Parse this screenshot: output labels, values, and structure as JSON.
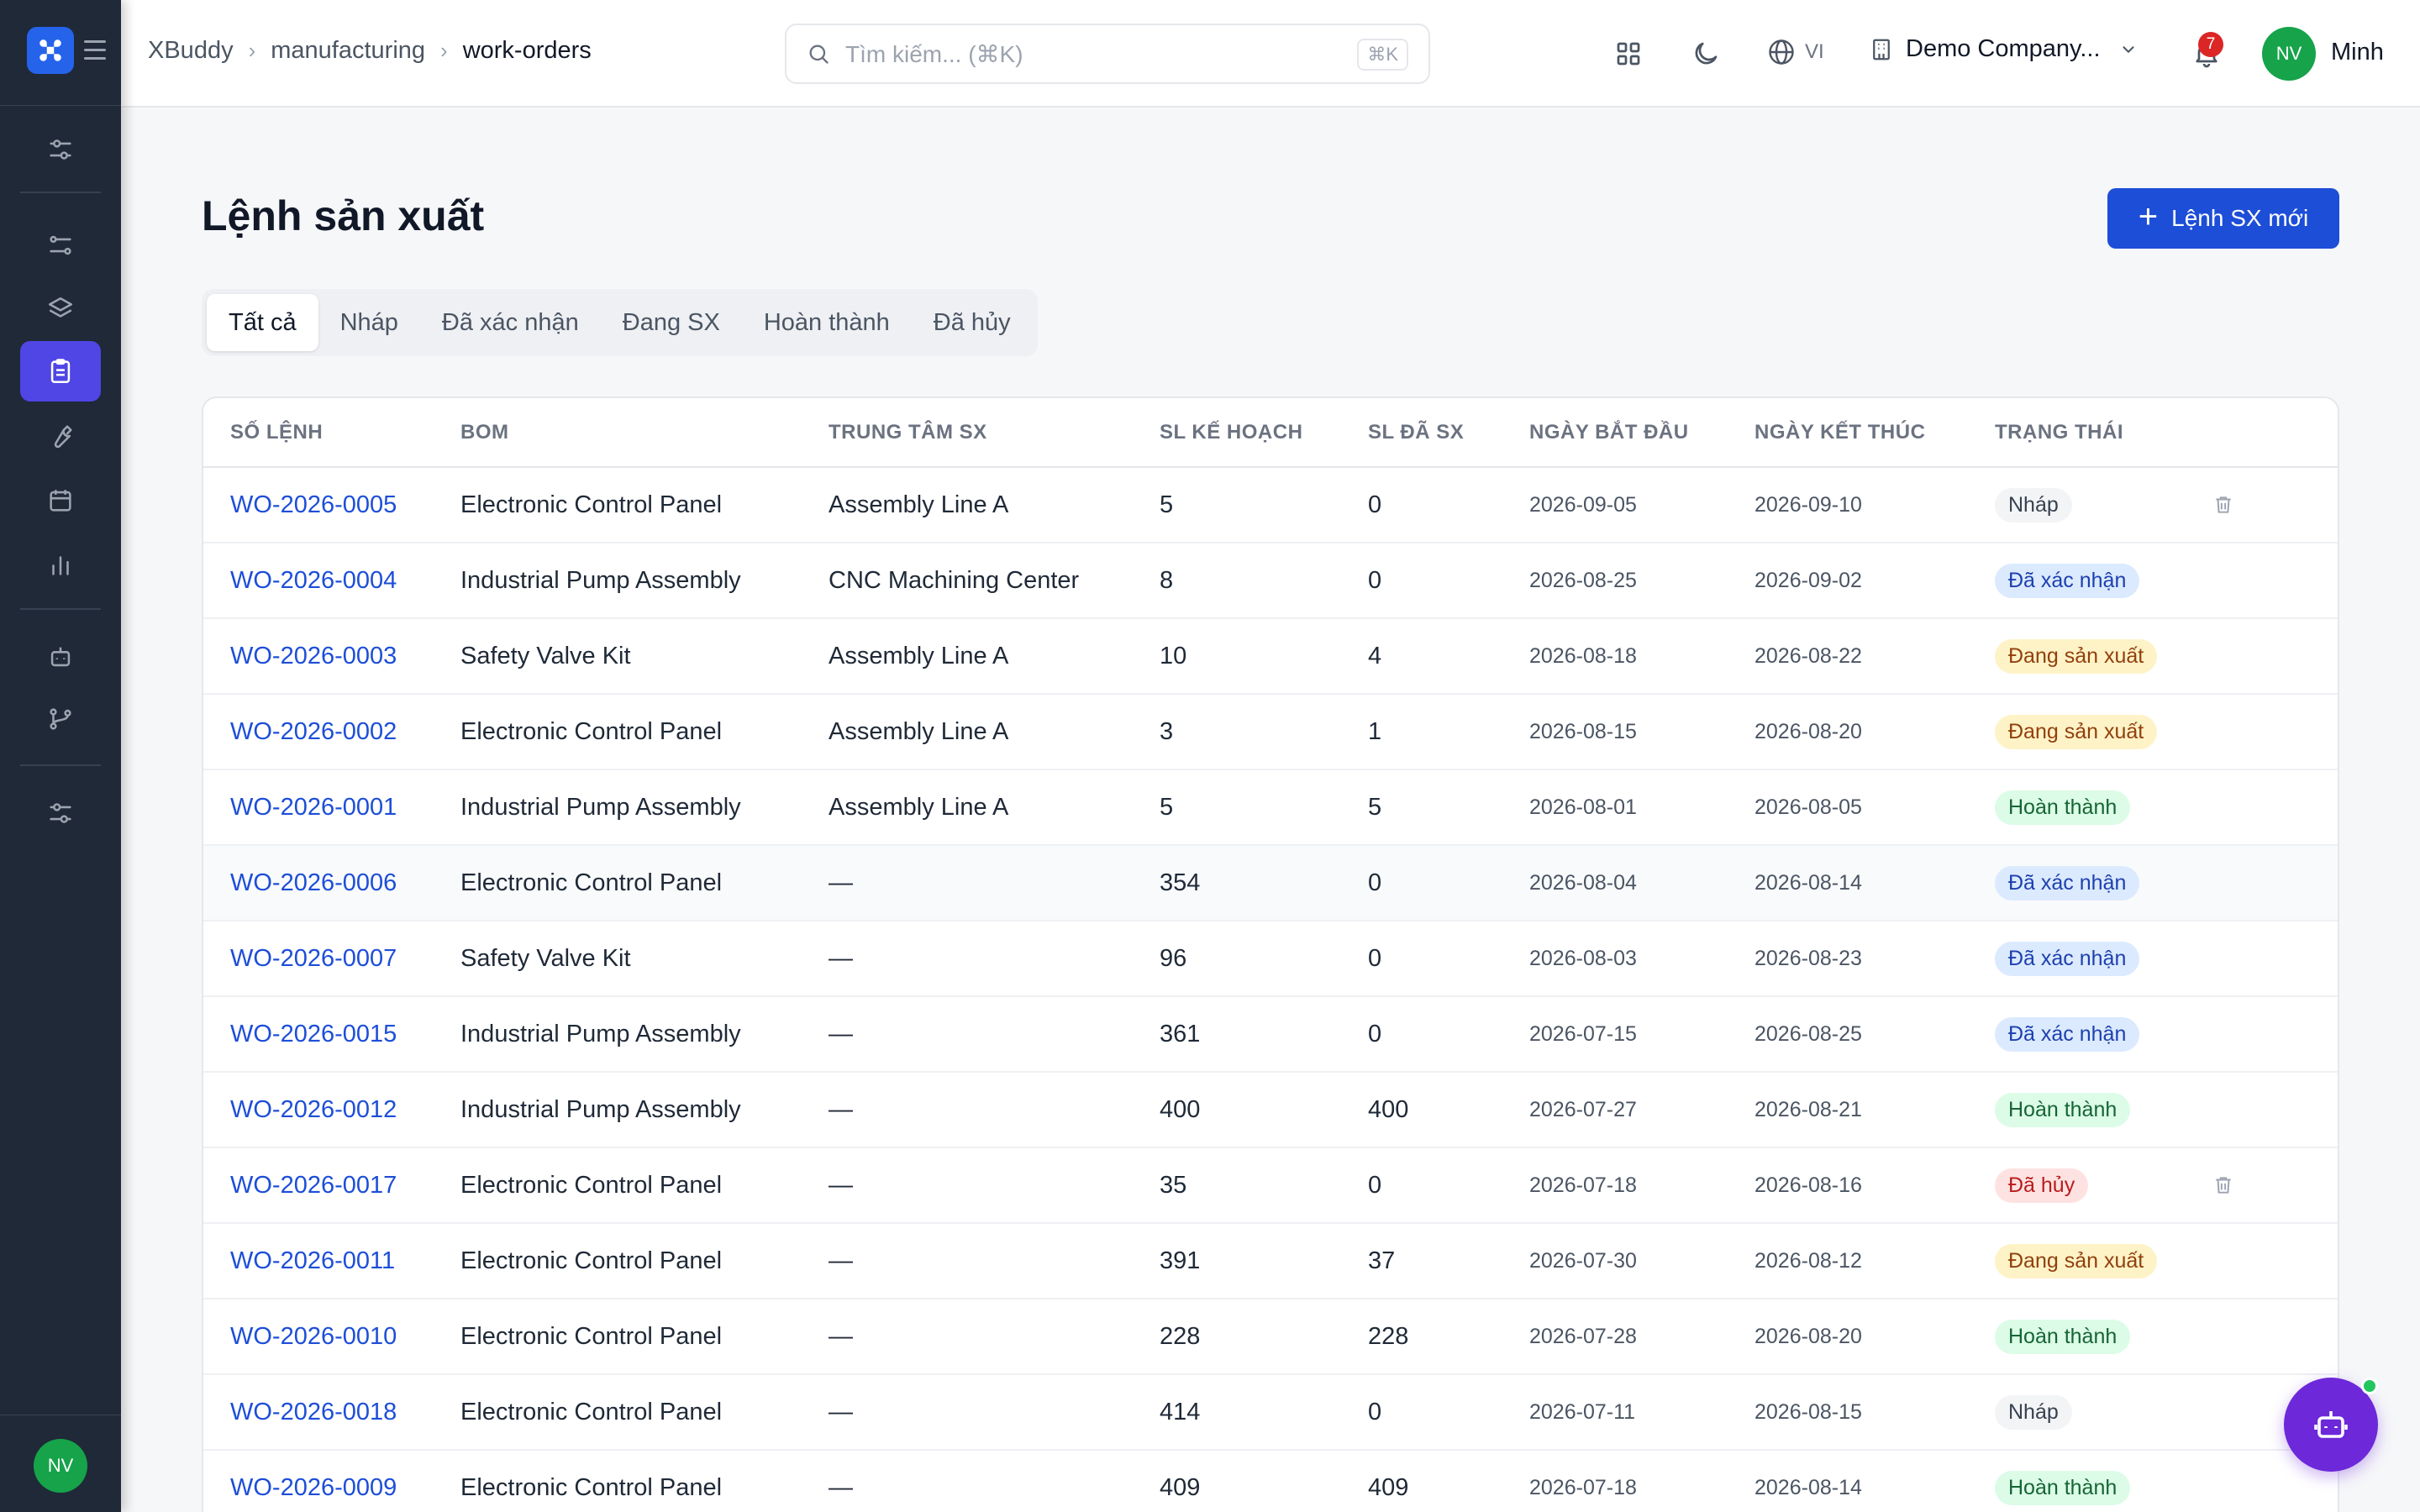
{
  "breadcrumb": [
    "XBuddy",
    "manufacturing",
    "work-orders"
  ],
  "search": {
    "placeholder": "Tìm kiếm... (⌘K)",
    "shortcut": "⌘K"
  },
  "header": {
    "language": "VI",
    "company": "Demo Company...",
    "notification_count": "7",
    "user_initials": "NV",
    "user_name": "Minh"
  },
  "sidebar": {
    "active_item": "work-orders",
    "user_initials": "NV"
  },
  "page": {
    "title": "Lệnh sản xuất",
    "new_button": "Lệnh SX mới"
  },
  "tabs": [
    "Tất cả",
    "Nháp",
    "Đã xác nhận",
    "Đang SX",
    "Hoàn thành",
    "Đã hủy"
  ],
  "table": {
    "columns": [
      "SỐ LỆNH",
      "BOM",
      "TRUNG TÂM SX",
      "SL KẾ HOẠCH",
      "SL ĐÃ SX",
      "NGÀY BẮT ĐẦU",
      "NGÀY KẾT THÚC",
      "TRẠNG THÁI"
    ],
    "rows": [
      {
        "wo": "WO-2026-0005",
        "bom": "Electronic Control Panel",
        "center": "Assembly Line A",
        "planned": "5",
        "produced": "0",
        "start": "2026-09-05",
        "end": "2026-09-10",
        "status": "Nháp",
        "status_kind": "draft",
        "deletable": true
      },
      {
        "wo": "WO-2026-0004",
        "bom": "Industrial Pump Assembly",
        "center": "CNC Machining Center",
        "planned": "8",
        "produced": "0",
        "start": "2026-08-25",
        "end": "2026-09-02",
        "status": "Đã xác nhận",
        "status_kind": "confirmed",
        "deletable": false
      },
      {
        "wo": "WO-2026-0003",
        "bom": "Safety Valve Kit",
        "center": "Assembly Line A",
        "planned": "10",
        "produced": "4",
        "start": "2026-08-18",
        "end": "2026-08-22",
        "status": "Đang sản xuất",
        "status_kind": "progress",
        "deletable": false
      },
      {
        "wo": "WO-2026-0002",
        "bom": "Electronic Control Panel",
        "center": "Assembly Line A",
        "planned": "3",
        "produced": "1",
        "start": "2026-08-15",
        "end": "2026-08-20",
        "status": "Đang sản xuất",
        "status_kind": "progress",
        "deletable": false
      },
      {
        "wo": "WO-2026-0001",
        "bom": "Industrial Pump Assembly",
        "center": "Assembly Line A",
        "planned": "5",
        "produced": "5",
        "start": "2026-08-01",
        "end": "2026-08-05",
        "status": "Hoàn thành",
        "status_kind": "done",
        "deletable": false
      },
      {
        "wo": "WO-2026-0006",
        "bom": "Electronic Control Panel",
        "center": "—",
        "planned": "354",
        "produced": "0",
        "start": "2026-08-04",
        "end": "2026-08-14",
        "status": "Đã xác nhận",
        "status_kind": "confirmed",
        "deletable": false
      },
      {
        "wo": "WO-2026-0007",
        "bom": "Safety Valve Kit",
        "center": "—",
        "planned": "96",
        "produced": "0",
        "start": "2026-08-03",
        "end": "2026-08-23",
        "status": "Đã xác nhận",
        "status_kind": "confirmed",
        "deletable": false
      },
      {
        "wo": "WO-2026-0015",
        "bom": "Industrial Pump Assembly",
        "center": "—",
        "planned": "361",
        "produced": "0",
        "start": "2026-07-15",
        "end": "2026-08-25",
        "status": "Đã xác nhận",
        "status_kind": "confirmed",
        "deletable": false
      },
      {
        "wo": "WO-2026-0012",
        "bom": "Industrial Pump Assembly",
        "center": "—",
        "planned": "400",
        "produced": "400",
        "start": "2026-07-27",
        "end": "2026-08-21",
        "status": "Hoàn thành",
        "status_kind": "done",
        "deletable": false
      },
      {
        "wo": "WO-2026-0017",
        "bom": "Electronic Control Panel",
        "center": "—",
        "planned": "35",
        "produced": "0",
        "start": "2026-07-18",
        "end": "2026-08-16",
        "status": "Đã hủy",
        "status_kind": "cancel",
        "deletable": true
      },
      {
        "wo": "WO-2026-0011",
        "bom": "Electronic Control Panel",
        "center": "—",
        "planned": "391",
        "produced": "37",
        "start": "2026-07-30",
        "end": "2026-08-12",
        "status": "Đang sản xuất",
        "status_kind": "progress",
        "deletable": false
      },
      {
        "wo": "WO-2026-0010",
        "bom": "Electronic Control Panel",
        "center": "—",
        "planned": "228",
        "produced": "228",
        "start": "2026-07-28",
        "end": "2026-08-20",
        "status": "Hoàn thành",
        "status_kind": "done",
        "deletable": false
      },
      {
        "wo": "WO-2026-0018",
        "bom": "Electronic Control Panel",
        "center": "—",
        "planned": "414",
        "produced": "0",
        "start": "2026-07-11",
        "end": "2026-08-15",
        "status": "Nháp",
        "status_kind": "draft",
        "deletable": false
      },
      {
        "wo": "WO-2026-0009",
        "bom": "Electronic Control Panel",
        "center": "—",
        "planned": "409",
        "produced": "409",
        "start": "2026-07-18",
        "end": "2026-08-14",
        "status": "Hoàn thành",
        "status_kind": "done",
        "deletable": false
      }
    ]
  },
  "colors": {
    "sidebar_bg": "#1f2937",
    "active_nav": "#4f46e5",
    "primary": "#1d4ed8",
    "link": "#1d4ed8",
    "bot": "#6d28d9"
  }
}
